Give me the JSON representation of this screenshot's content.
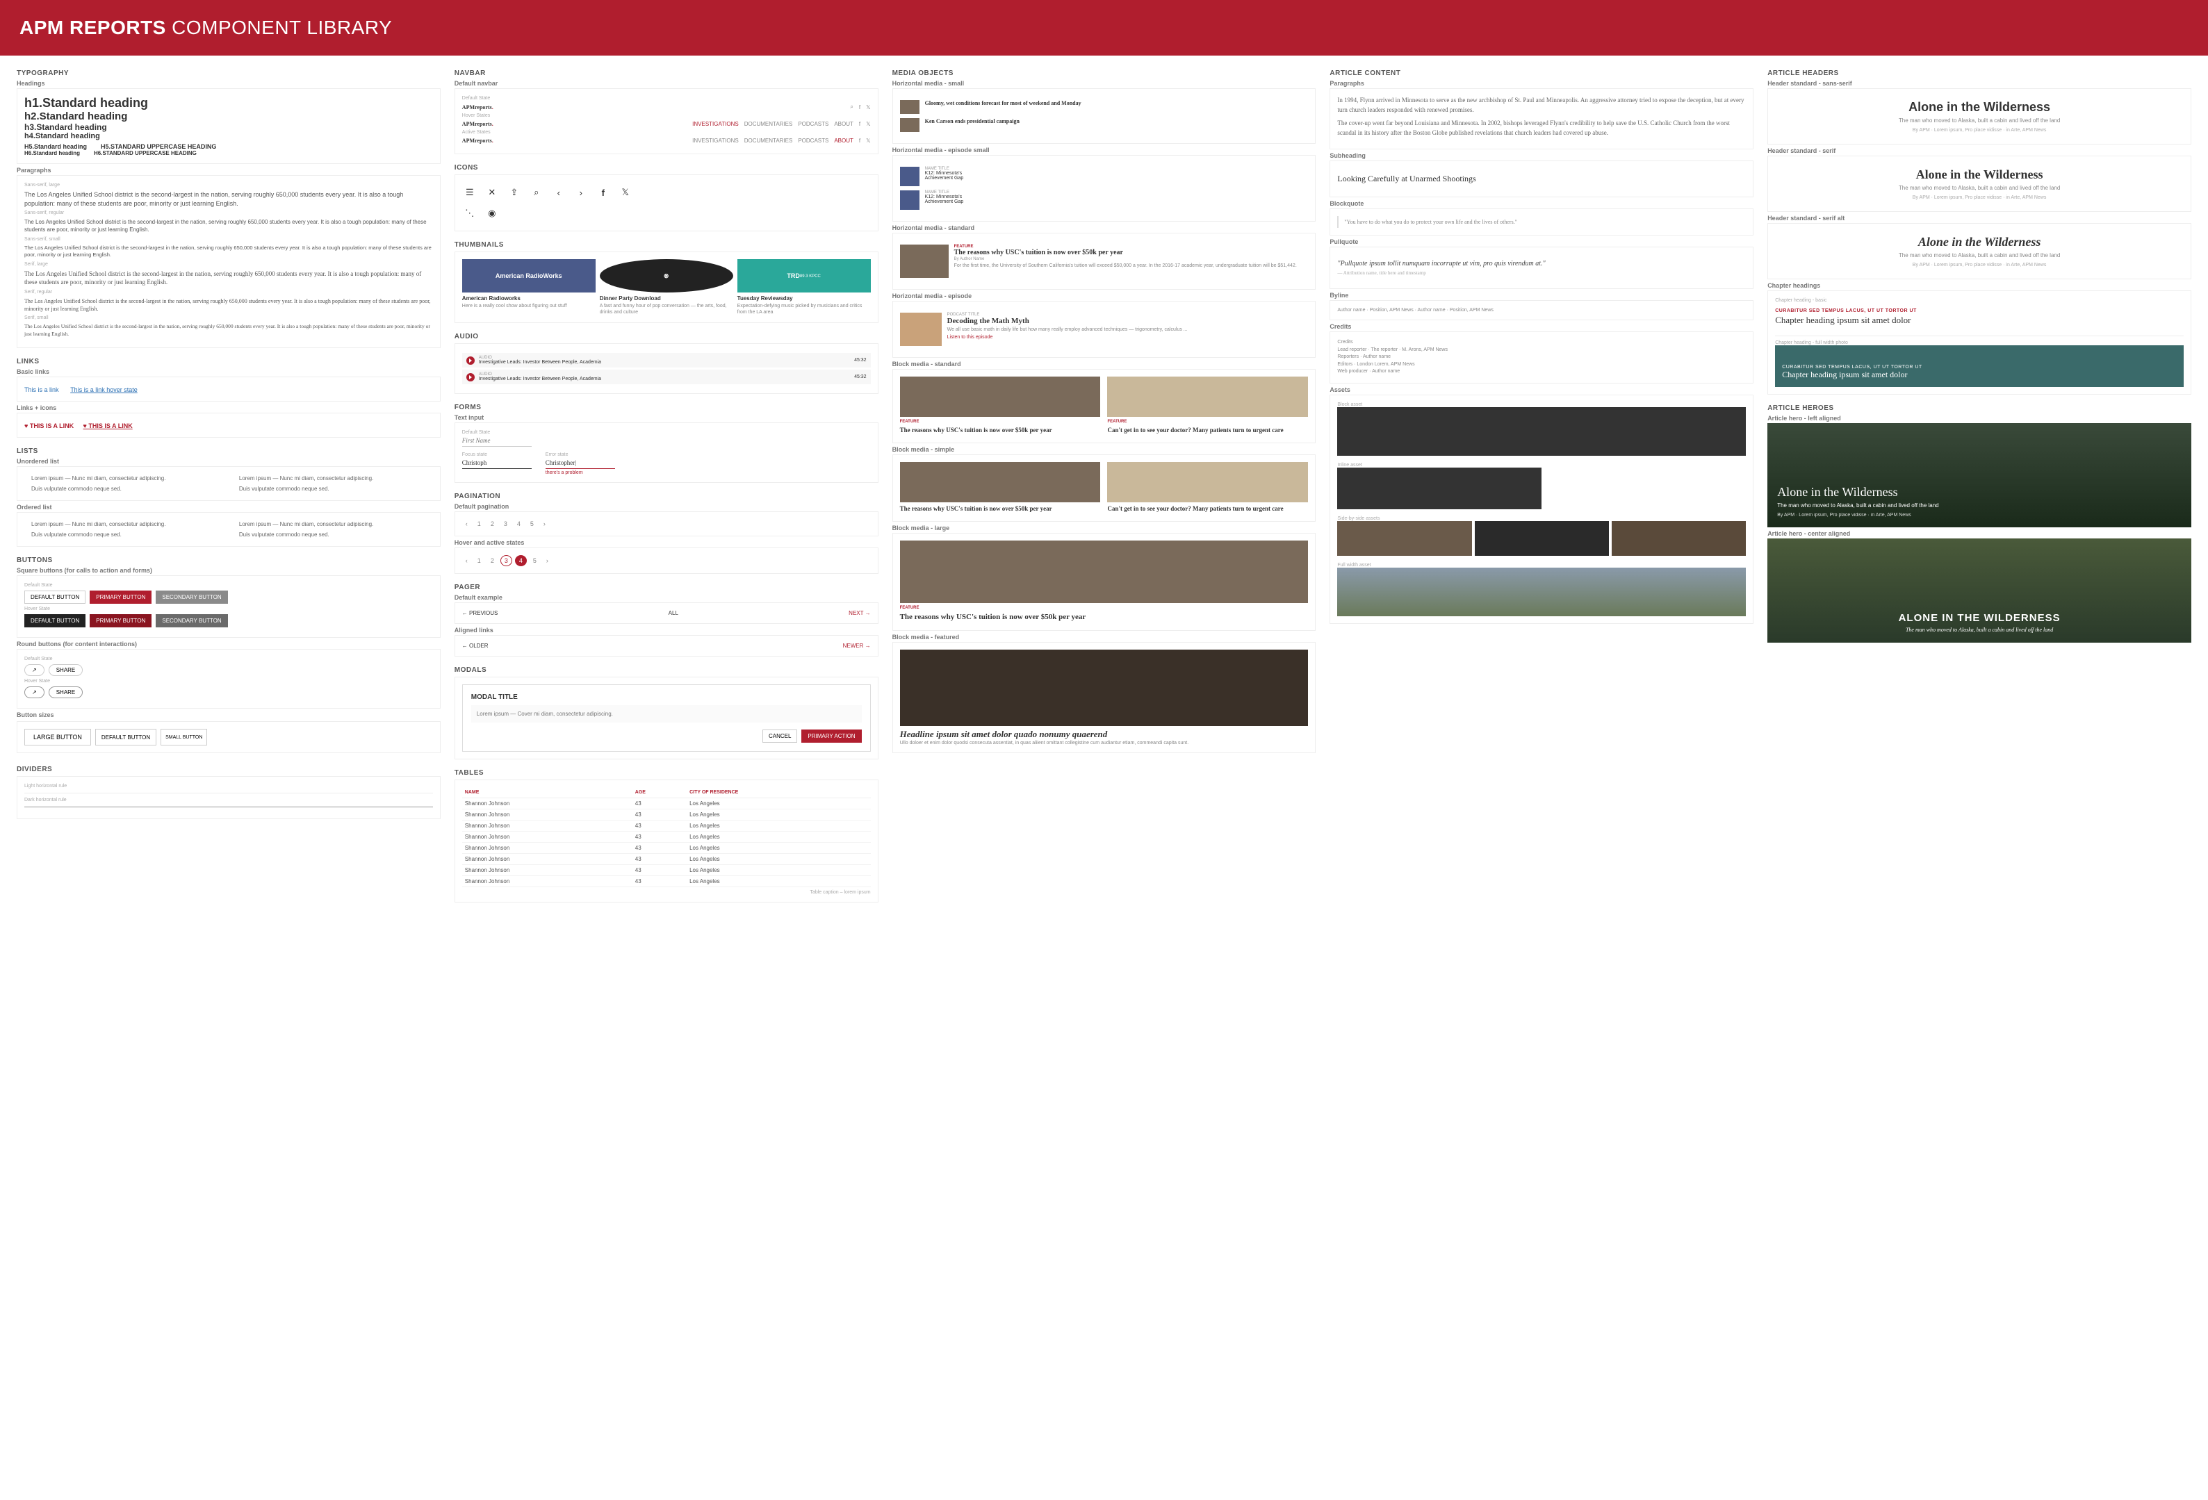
{
  "header": {
    "brand": "APM REPORTS",
    "subtitle": "COMPONENT LIBRARY"
  },
  "sections": {
    "typography": "TYPOGRAPHY",
    "headings": "Headings",
    "paragraphs": "Paragraphs",
    "links": "LINKS",
    "basic_links": "Basic links",
    "links_icons": "Links + icons",
    "lists": "LISTS",
    "ul": "Unordered list",
    "ol": "Ordered list",
    "buttons": "BUTTONS",
    "sq_buttons": "Square buttons (for calls to action and forms)",
    "rd_buttons": "Round buttons (for content interactions)",
    "btn_sizes": "Button sizes",
    "dividers": "DIVIDERS",
    "navbar": "NAVBAR",
    "icons": "ICONS",
    "forms": "FORMS",
    "text_input": "Text input",
    "pagination": "PAGINATION",
    "pager": "PAGER",
    "modals": "MODALS",
    "tables": "TABLES",
    "thumbnails": "THUMBNAILS",
    "audio": "AUDIO",
    "media_objects": "MEDIA OBJECTS",
    "article_content": "ARTICLE CONTENT",
    "article_headers": "ARTICLE HEADERS",
    "article_heroes": "ARTICLE HEROES"
  },
  "sub": {
    "default_navbar": "Default navbar",
    "hover_states": "Hover States",
    "active_states": "Active States",
    "default_state": "Default State",
    "hover_state": "Hover State",
    "focus_state": "Focus state",
    "error_state": "Error state",
    "default_pagination": "Default pagination",
    "hover_active_states": "Hover and active states",
    "default_example": "Default example",
    "aligned_links": "Aligned links",
    "hm_small": "Horizontal media - small",
    "hm_ep_small": "Horizontal media - episode small",
    "hm_standard": "Horizontal media - standard",
    "hm_episode": "Horizontal media - episode",
    "bm_standard": "Block media - standard",
    "bm_simple": "Block media - simple",
    "bm_large": "Block media - large",
    "bm_featured": "Block media - featured",
    "para_label": "Paragraphs",
    "subheading": "Subheading",
    "blockquote": "Blockquote",
    "pullquote": "Pullquote",
    "byline": "Byline",
    "credits": "Credits",
    "assets": "Assets",
    "block_asset": "Block asset",
    "inline_asset": "Inline asset",
    "side_by_side": "Side-by-side assets",
    "full_width": "Full width asset",
    "hdr_sans": "Header standard - sans-serif",
    "hdr_serif": "Header standard - serif",
    "hdr_serif_alt": "Header standard - serif alt",
    "chapter_headings": "Chapter headings",
    "chapter_basic": "Chapter heading - basic",
    "chapter_img": "Chapter heading - full width photo",
    "hero_left": "Article hero - left aligned",
    "hero_center": "Article hero - center aligned",
    "light_rule": "Light horizontal rule",
    "dark_rule": "Dark horizontal rule",
    "sans_large": "Sans-serif, large",
    "sans_regular": "Sans-serif, regular",
    "sans_small": "Sans-serif, small",
    "serif_large": "Serif, large",
    "serif_regular": "Serif, regular",
    "serif_small": "Serif, small"
  },
  "typography": {
    "h1": "h1.Standard heading",
    "h2": "h2.Standard heading",
    "h3": "h3.Standard heading",
    "h4": "h4.Standard heading",
    "h5": "H5.Standard heading",
    "h5u": "H5.STANDARD UPPERCASE HEADING",
    "h6": "H6.Standard heading",
    "h6u": "H6.STANDARD UPPERCASE HEADING",
    "p_large": "The Los Angeles Unified School district is the second-largest in the nation, serving roughly 650,000 students every year. It is also a tough population: many of these students are poor, minority or just learning English.",
    "p_regular": "The Los Angeles Unified School district is the second-largest in the nation, serving roughly 650,000 students every year. It is also a tough population: many of these students are poor, minority or just learning English.",
    "p_small": "The Los Angeles Unified School district is the second-largest in the nation, serving roughly 650,000 students every year. It is also a tough population: many of these students are poor, minority or just learning English."
  },
  "links": {
    "link1": "This is a link",
    "link2": "This is a link hover state",
    "icon_link1": "♥ THIS IS A LINK",
    "icon_link2": "♥ THIS IS A LINK"
  },
  "lists": {
    "item": "Lorem ipsum — Nunc mi diam, consectetur adipiscing.",
    "item2": "Duis vulputate commodo neque sed."
  },
  "buttons": {
    "default": "DEFAULT BUTTON",
    "primary": "PRIMARY BUTTON",
    "secondary": "SECONDARY BUTTON",
    "share": "SHARE",
    "large": "LARGE BUTTON",
    "def": "DEFAULT BUTTON",
    "small": "SMALL BUTTON",
    "cancel": "CANCEL",
    "primary_action": "PRIMARY ACTION"
  },
  "navbar": {
    "brand": "APMreports",
    "item1": "INVESTIGATIONS",
    "item2": "DOCUMENTARIES",
    "item3": "PODCASTS",
    "item4": "ABOUT"
  },
  "forms": {
    "placeholder": "First Name",
    "value": "Christoph",
    "value_err": "Christopher|",
    "err": "there's a problem"
  },
  "pagination": {
    "prev": "‹",
    "next": "›",
    "p1": "1",
    "p2": "2",
    "p3": "3",
    "p4": "4",
    "p5": "5"
  },
  "pager": {
    "prev": "← PREVIOUS",
    "all": "ALL",
    "next": "NEXT →",
    "older": "← OLDER",
    "newer": "NEWER →"
  },
  "modal": {
    "title": "MODAL TITLE",
    "body": "Lorem ipsum — Cover mi diam, consectetur adipiscing."
  },
  "table": {
    "cols": [
      "NAME",
      "AGE",
      "CITY OF RESIDENCE"
    ],
    "rows": [
      [
        "Shannon Johnson",
        "43",
        "Los Angeles"
      ],
      [
        "Shannon Johnson",
        "43",
        "Los Angeles"
      ],
      [
        "Shannon Johnson",
        "43",
        "Los Angeles"
      ],
      [
        "Shannon Johnson",
        "43",
        "Los Angeles"
      ],
      [
        "Shannon Johnson",
        "43",
        "Los Angeles"
      ],
      [
        "Shannon Johnson",
        "43",
        "Los Angeles"
      ],
      [
        "Shannon Johnson",
        "43",
        "Los Angeles"
      ],
      [
        "Shannon Johnson",
        "43",
        "Los Angeles"
      ]
    ],
    "caption": "Table caption – lorem ipsum"
  },
  "thumbs": [
    {
      "img": "American RadioWorks",
      "title": "American Radioworks",
      "desc": "Here is a really cool show about figuring out stuff"
    },
    {
      "img": "⊗",
      "title": "Dinner Party Download",
      "desc": "A fast and funny hour of pop conversation — the arts, food, drinks and culture"
    },
    {
      "img": "TRD",
      "sub": "89.3 KPCC",
      "title": "Tuesday Reviewsday",
      "desc": "Expectation-defying music picked by musicians and critics from the LA area"
    }
  ],
  "audio": {
    "label1": "AUDIO",
    "title": "Investigative Leads: Investor Between People, Academia",
    "time": "45:32"
  },
  "media": {
    "small1": "Gloomy, wet conditions forecast for most of weekend and Monday",
    "small2": "Ken Carson ends presidential campaign",
    "ep_kicker": "NAME TITLE",
    "ep_line2": "K12: Minnesota's",
    "ep_line3": "Achievement Gap",
    "std_kicker": "FEATURE",
    "std_title": "The reasons why USC's tuition is now over $50k per year",
    "std_by": "By Author Name",
    "std_desc": "For the first time, the University of Southern California's tuition will exceed $50,000 a year. In the 2016-17 academic year, undergraduate tuition will be $51,442.",
    "ep_title_kicker": "PODCAST TITLE",
    "ep_title": "Decoding the Math Myth",
    "ep_desc": "We all use basic math in daily life but how many really employ advanced techniques — trigonometry, calculus ...",
    "ep_listen": "Listen to this episode",
    "block2_title": "Can't get in to see your doctor? Many patients turn to urgent care",
    "feat_title": "Headline ipsum sit amet dolor quado nonumy quaerend",
    "feat_desc": "Ullo doloer et enim dolor quodsi consecuta assentiat, in quas aliient omittant collegistine cum audiantur etiam, commeandi capita sunt."
  },
  "article": {
    "p1": "In 1994, Flynn arrived in Minnesota to serve as the new archbishop of St. Paul and Minneapolis. An aggressive attorney tried to expose the deception, but at every turn church leaders responded with renewed promises.",
    "p2": "The cover-up went far beyond Louisiana and Minnesota. In 2002, bishops leveraged Flynn's credibility to help save the U.S. Catholic Church from the worst scandal in its history after the Boston Globe published revelations that church leaders had covered up abuse.",
    "subheading": "Looking Carefully at Unarmed Shootings",
    "blockquote": "\"You have to do what you do to protect your own life and the lives of others.\"",
    "pullquote": "\"Pullquote ipsum tollit numquam incorrupte ut vim, pro quis virendum at.\"",
    "pq_attr": "— Attribution name, title here and timestamp",
    "byline": "Author name · Position, APM News · Author name · Position, APM News",
    "credits_l1": "Credits",
    "credits_l2": "Lead reporter · The reporter · M. Arons, APM News",
    "credits_l3": "Reporters · Author name",
    "credits_l4": "Editors · London Lorem, APM News",
    "credits_l5": "Web producer · Author name"
  },
  "headers": {
    "title": "Alone in the Wilderness",
    "sub": "The man who moved to Alaska, built a cabin and lived off the land",
    "meta": "By APM · Lorem ipsum, Pro place vidisse · in Arte, APM News",
    "kicker": "CURABITUR SED TEMPUS LACUS, UT UT TORTOR UT",
    "chapter": "Chapter heading ipsum sit amet dolor"
  },
  "hero": {
    "title": "Alone in the Wilderness",
    "title_upper": "ALONE IN THE WILDERNESS",
    "sub": "The man who moved to Alaska, built a cabin and lived off the land",
    "meta": "By APM · Lorem ipsum, Pro place vidisse · in Arte, APM News"
  }
}
